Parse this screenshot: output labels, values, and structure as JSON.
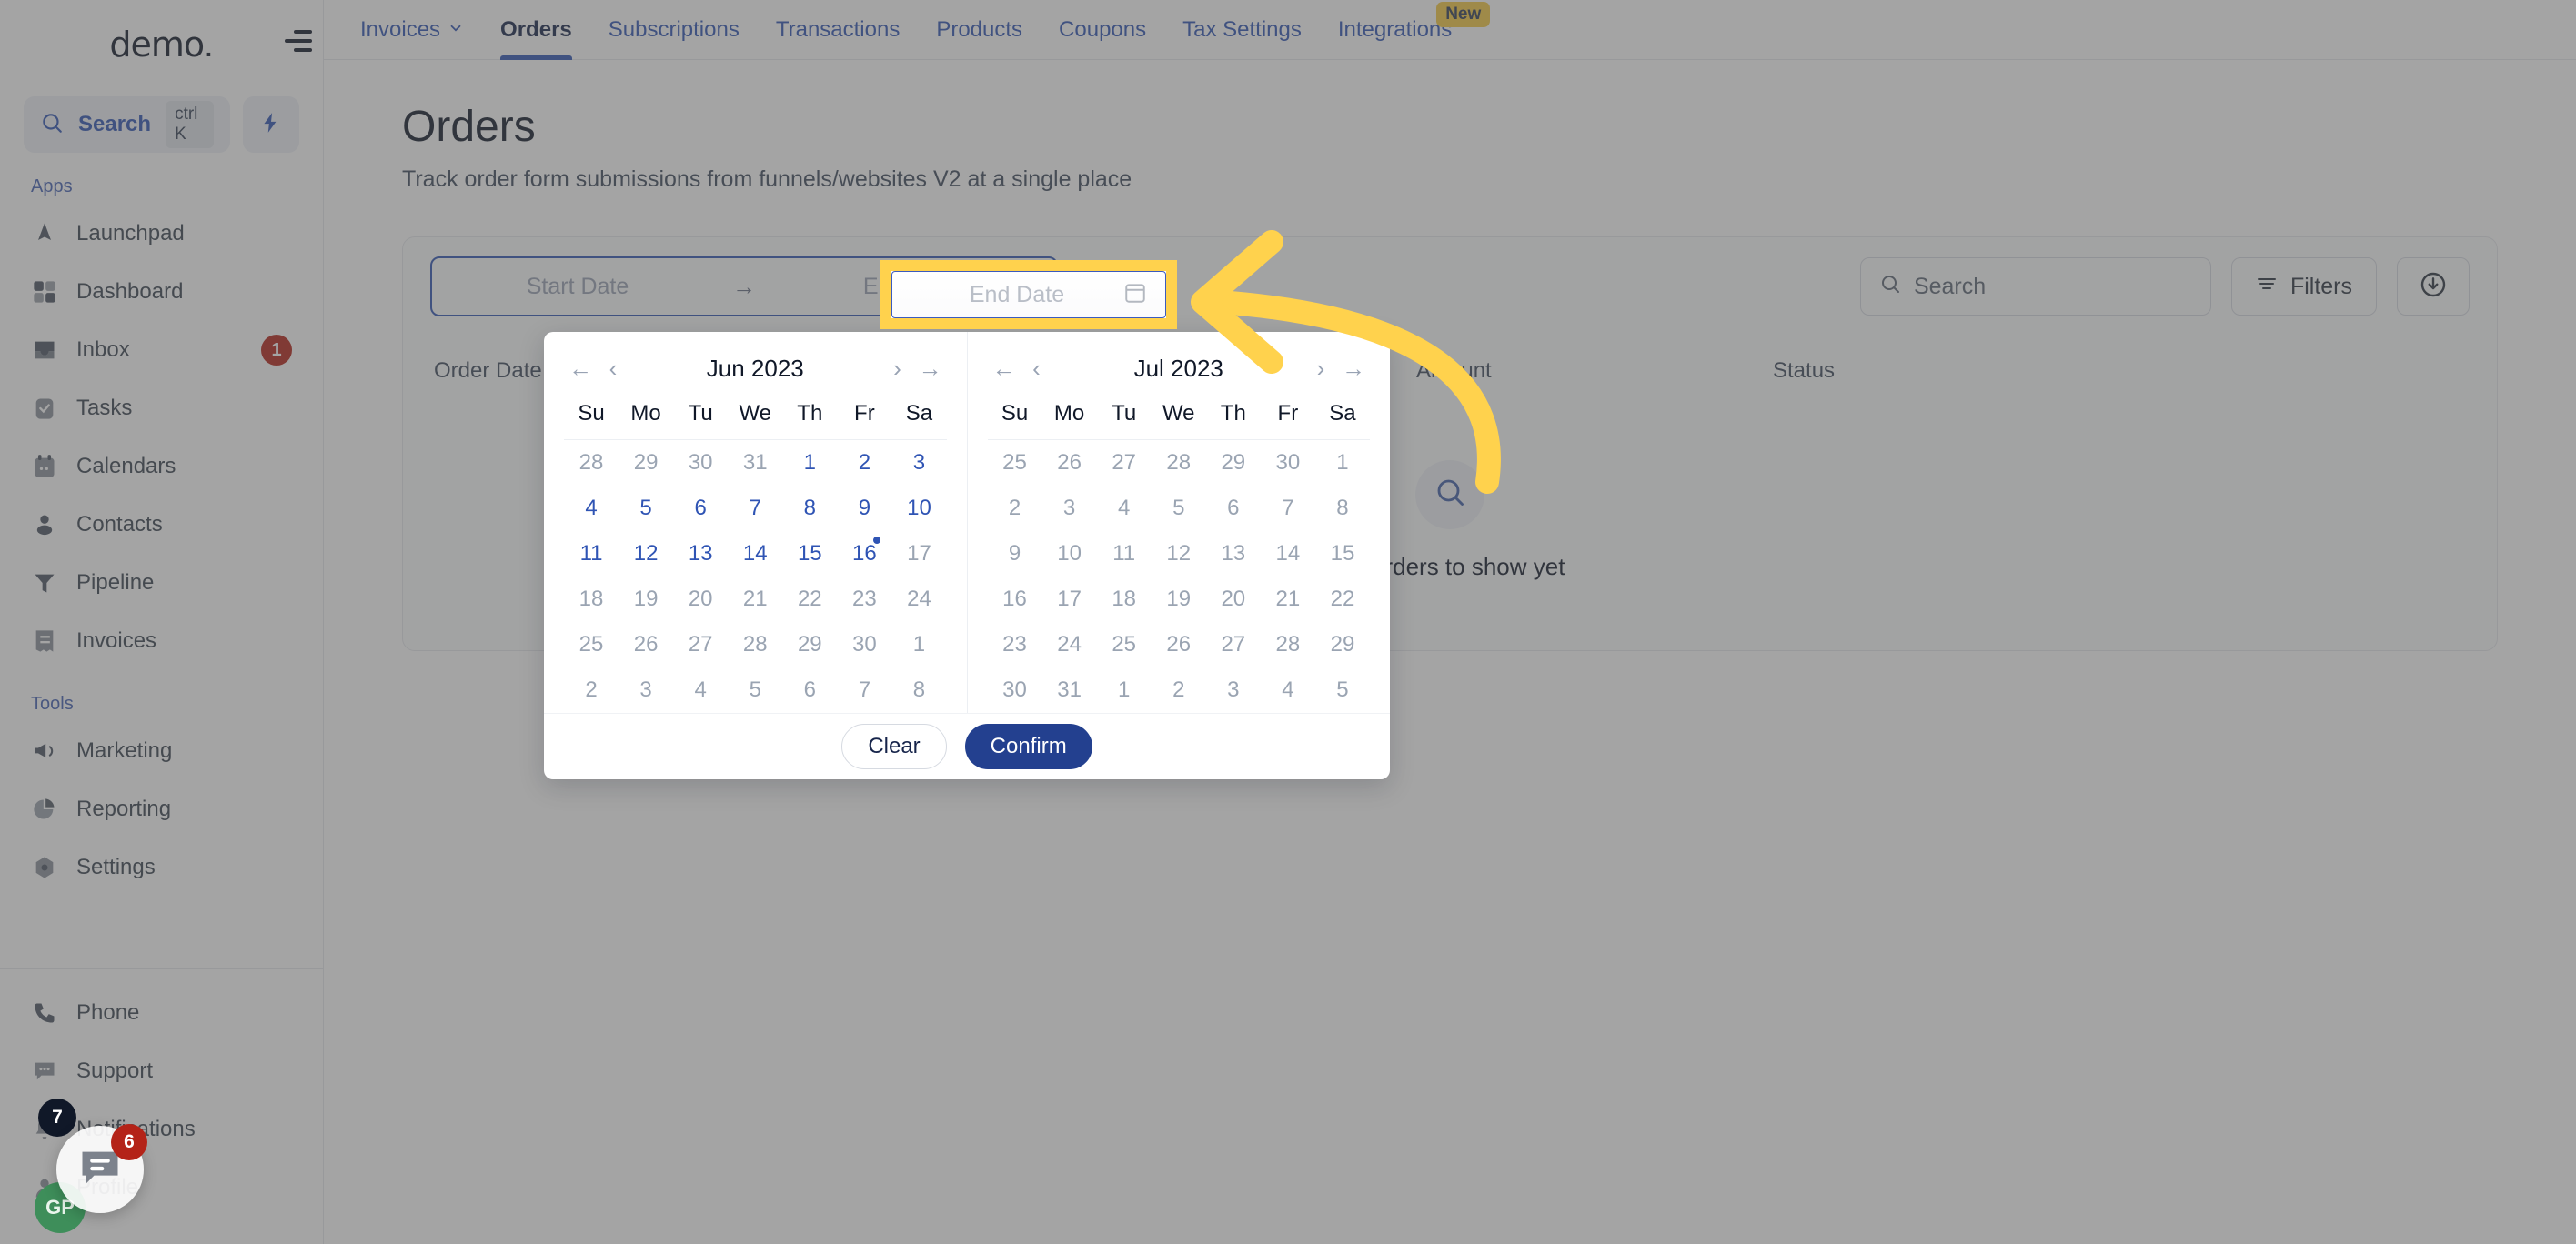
{
  "brand": {
    "name": "demo",
    "dot": "."
  },
  "sidebar": {
    "search": {
      "label": "Search",
      "shortcut": "ctrl K",
      "icon": "search-icon"
    },
    "bolt_icon": "lightning-bolt-icon",
    "sections": [
      {
        "caption": "Apps",
        "items": [
          {
            "label": "Launchpad",
            "icon": "launchpad-icon"
          },
          {
            "label": "Dashboard",
            "icon": "dashboard-grid-icon"
          },
          {
            "label": "Inbox",
            "icon": "inbox-icon",
            "badge": "1"
          },
          {
            "label": "Tasks",
            "icon": "tasks-clipboard-icon"
          },
          {
            "label": "Calendars",
            "icon": "calendar-icon"
          },
          {
            "label": "Contacts",
            "icon": "contacts-person-icon"
          },
          {
            "label": "Pipeline",
            "icon": "pipeline-funnel-icon"
          },
          {
            "label": "Invoices",
            "icon": "invoice-icon"
          }
        ]
      },
      {
        "caption": "Tools",
        "items": [
          {
            "label": "Marketing",
            "icon": "megaphone-icon"
          },
          {
            "label": "Reporting",
            "icon": "pie-chart-icon"
          },
          {
            "label": "Settings",
            "icon": "gear-icon"
          }
        ]
      }
    ],
    "footer_items": [
      {
        "label": "Phone",
        "icon": "phone-icon"
      },
      {
        "label": "Support",
        "icon": "chat-dots-icon"
      },
      {
        "label": "Notifications",
        "icon": "bell-icon"
      },
      {
        "label": "Profile",
        "icon": "profile-icon"
      }
    ],
    "floating": {
      "chat_badge": "6",
      "bell_badge": "7",
      "avatar_initials": "GP"
    }
  },
  "topnav": {
    "tabs": [
      {
        "label": "Invoices",
        "dropdown": true,
        "active": false
      },
      {
        "label": "Orders",
        "dropdown": false,
        "active": true
      },
      {
        "label": "Subscriptions",
        "dropdown": false,
        "active": false
      },
      {
        "label": "Transactions",
        "dropdown": false,
        "active": false
      },
      {
        "label": "Products",
        "dropdown": false,
        "active": false
      },
      {
        "label": "Coupons",
        "dropdown": false,
        "active": false
      },
      {
        "label": "Tax Settings",
        "dropdown": false,
        "active": false
      },
      {
        "label": "Integrations",
        "dropdown": false,
        "active": false,
        "badge": "New"
      }
    ]
  },
  "page": {
    "title": "Orders",
    "subtitle": "Track order form submissions from funnels/websites V2 at a single place"
  },
  "toolbar": {
    "start_date_placeholder": "Start Date",
    "end_date_placeholder": "End Date",
    "range_arrow": "→",
    "search_placeholder": "Search",
    "filters_label": "Filters",
    "download_icon": "download-circle-icon",
    "calendar_icon": "calendar-icon"
  },
  "table": {
    "columns": [
      "Order Date",
      "Amount",
      "Status"
    ],
    "rows": [],
    "empty_message": "No orders to show yet",
    "empty_icon": "search-icon"
  },
  "calendar": {
    "left": {
      "title": "Jun 2023",
      "dow": [
        "Su",
        "Mo",
        "Tu",
        "We",
        "Th",
        "Fr",
        "Sa"
      ],
      "weeks": [
        [
          {
            "d": "28",
            "on": false
          },
          {
            "d": "29",
            "on": false
          },
          {
            "d": "30",
            "on": false
          },
          {
            "d": "31",
            "on": false
          },
          {
            "d": "1",
            "on": true
          },
          {
            "d": "2",
            "on": true
          },
          {
            "d": "3",
            "on": true
          }
        ],
        [
          {
            "d": "4",
            "on": true
          },
          {
            "d": "5",
            "on": true
          },
          {
            "d": "6",
            "on": true
          },
          {
            "d": "7",
            "on": true
          },
          {
            "d": "8",
            "on": true
          },
          {
            "d": "9",
            "on": true
          },
          {
            "d": "10",
            "on": true
          }
        ],
        [
          {
            "d": "11",
            "on": true
          },
          {
            "d": "12",
            "on": true
          },
          {
            "d": "13",
            "on": true
          },
          {
            "d": "14",
            "on": true
          },
          {
            "d": "15",
            "on": true
          },
          {
            "d": "16",
            "on": true,
            "today": true
          },
          {
            "d": "17",
            "on": false
          }
        ],
        [
          {
            "d": "18",
            "on": false
          },
          {
            "d": "19",
            "on": false
          },
          {
            "d": "20",
            "on": false
          },
          {
            "d": "21",
            "on": false
          },
          {
            "d": "22",
            "on": false
          },
          {
            "d": "23",
            "on": false
          },
          {
            "d": "24",
            "on": false
          }
        ],
        [
          {
            "d": "25",
            "on": false
          },
          {
            "d": "26",
            "on": false
          },
          {
            "d": "27",
            "on": false
          },
          {
            "d": "28",
            "on": false
          },
          {
            "d": "29",
            "on": false
          },
          {
            "d": "30",
            "on": false
          },
          {
            "d": "1",
            "on": false
          }
        ],
        [
          {
            "d": "2",
            "on": false
          },
          {
            "d": "3",
            "on": false
          },
          {
            "d": "4",
            "on": false
          },
          {
            "d": "5",
            "on": false
          },
          {
            "d": "6",
            "on": false
          },
          {
            "d": "7",
            "on": false
          },
          {
            "d": "8",
            "on": false
          }
        ]
      ]
    },
    "right": {
      "title": "Jul 2023",
      "dow": [
        "Su",
        "Mo",
        "Tu",
        "We",
        "Th",
        "Fr",
        "Sa"
      ],
      "weeks": [
        [
          {
            "d": "25",
            "on": false
          },
          {
            "d": "26",
            "on": false
          },
          {
            "d": "27",
            "on": false
          },
          {
            "d": "28",
            "on": false
          },
          {
            "d": "29",
            "on": false
          },
          {
            "d": "30",
            "on": false
          },
          {
            "d": "1",
            "on": false
          }
        ],
        [
          {
            "d": "2",
            "on": false
          },
          {
            "d": "3",
            "on": false
          },
          {
            "d": "4",
            "on": false
          },
          {
            "d": "5",
            "on": false
          },
          {
            "d": "6",
            "on": false
          },
          {
            "d": "7",
            "on": false
          },
          {
            "d": "8",
            "on": false
          }
        ],
        [
          {
            "d": "9",
            "on": false
          },
          {
            "d": "10",
            "on": false
          },
          {
            "d": "11",
            "on": false
          },
          {
            "d": "12",
            "on": false
          },
          {
            "d": "13",
            "on": false
          },
          {
            "d": "14",
            "on": false
          },
          {
            "d": "15",
            "on": false
          }
        ],
        [
          {
            "d": "16",
            "on": false
          },
          {
            "d": "17",
            "on": false
          },
          {
            "d": "18",
            "on": false
          },
          {
            "d": "19",
            "on": false
          },
          {
            "d": "20",
            "on": false
          },
          {
            "d": "21",
            "on": false
          },
          {
            "d": "22",
            "on": false
          }
        ],
        [
          {
            "d": "23",
            "on": false
          },
          {
            "d": "24",
            "on": false
          },
          {
            "d": "25",
            "on": false
          },
          {
            "d": "26",
            "on": false
          },
          {
            "d": "27",
            "on": false
          },
          {
            "d": "28",
            "on": false
          },
          {
            "d": "29",
            "on": false
          }
        ],
        [
          {
            "d": "30",
            "on": false
          },
          {
            "d": "31",
            "on": false
          },
          {
            "d": "1",
            "on": false
          },
          {
            "d": "2",
            "on": false
          },
          {
            "d": "3",
            "on": false
          },
          {
            "d": "4",
            "on": false
          },
          {
            "d": "5",
            "on": false
          }
        ]
      ]
    },
    "nav": {
      "first": "←",
      "prev": "‹",
      "next": "›",
      "last": "→"
    },
    "clear_label": "Clear",
    "confirm_label": "Confirm"
  },
  "annotation": {
    "highlight_color": "#FFD24D",
    "arrow_color": "#FFD24D",
    "highlight_target": "end-date-field"
  },
  "colors": {
    "accent_blue": "#2f54b4",
    "confirm_blue": "#23408f",
    "badge_red": "#b42318",
    "badge_yellow": "#f5c842",
    "avatar_green": "#3e8e5a"
  }
}
